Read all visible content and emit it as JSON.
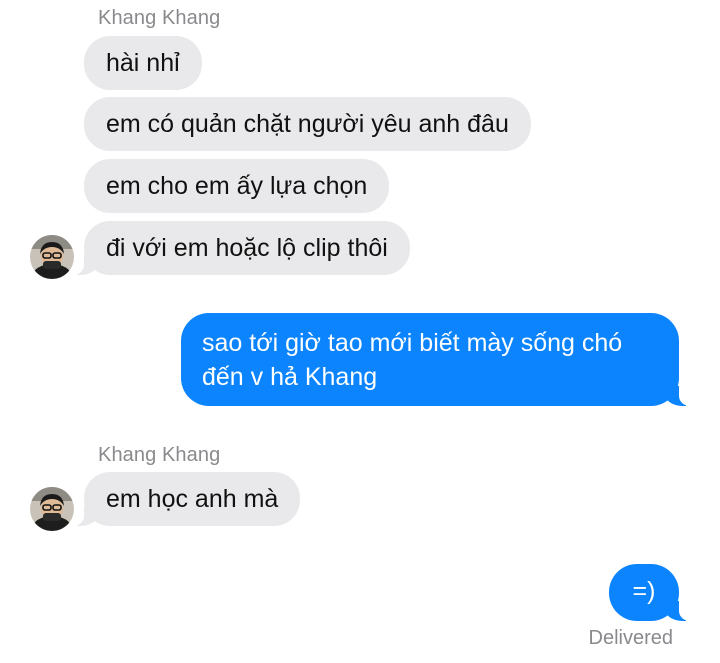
{
  "conversation": {
    "groups": [
      {
        "sender": "Khang Khang",
        "messages": [
          "hài nhỉ",
          "em có quản chặt người yêu anh đâu",
          "em cho em ấy lựa chọn",
          "đi với em hoặc lộ clip thôi"
        ]
      },
      {
        "outgoing": [
          "sao tới giờ tao mới biết mày sống chó đến v hả Khang"
        ]
      },
      {
        "sender": "Khang Khang",
        "messages": [
          "em học anh mà"
        ]
      },
      {
        "outgoing": [
          "=)"
        ],
        "status": "Delivered"
      }
    ]
  },
  "colors": {
    "incoming_bubble": "#e9e9eb",
    "outgoing_bubble": "#0b84fe",
    "meta_text": "#8a8a8e"
  },
  "icons": {
    "avatar": "contact-photo-avatar"
  }
}
